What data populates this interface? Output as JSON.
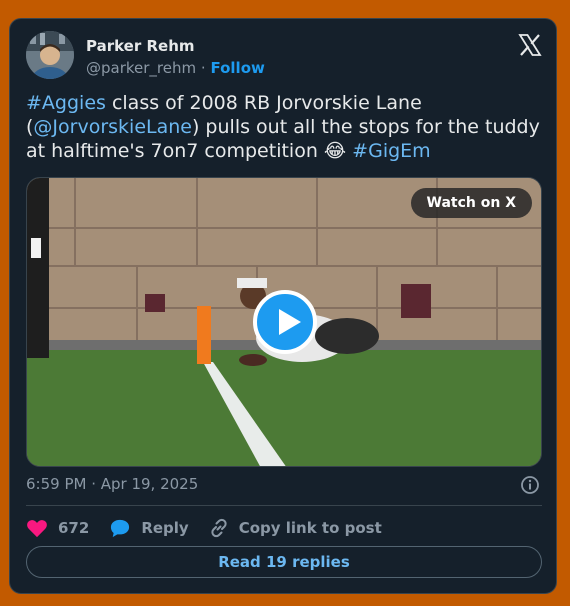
{
  "author": {
    "display_name": "Parker Rehm",
    "handle": "@parker_rehm",
    "separator": "·",
    "follow_label": "Follow"
  },
  "tweet": {
    "segments": [
      {
        "text": "#Aggies",
        "link": true
      },
      {
        "text": " class of 2008 RB Jorvorskie Lane (",
        "link": false
      },
      {
        "text": "@JorvorskieLane",
        "link": true
      },
      {
        "text": ") pulls out all the stops for the tuddy at halftime's 7on7 competition ",
        "link": false
      },
      {
        "text": "😂",
        "link": false
      },
      {
        "text": " ",
        "link": false
      },
      {
        "text": "#GigEm",
        "link": true
      }
    ]
  },
  "media": {
    "watch_label": "Watch on X"
  },
  "timestamp": "6:59 PM · Apr 19, 2025",
  "actions": {
    "like_count": "672",
    "reply_label": "Reply",
    "copy_label": "Copy link to post"
  },
  "read_replies_label": "Read 19 replies",
  "colors": {
    "background": "#c25a00",
    "card": "#15202b",
    "accent": "#1d9bf0",
    "like": "#f91880"
  },
  "icons": [
    "x-logo-icon",
    "play-icon",
    "info-icon",
    "heart-icon",
    "reply-bubble-icon",
    "link-icon"
  ]
}
